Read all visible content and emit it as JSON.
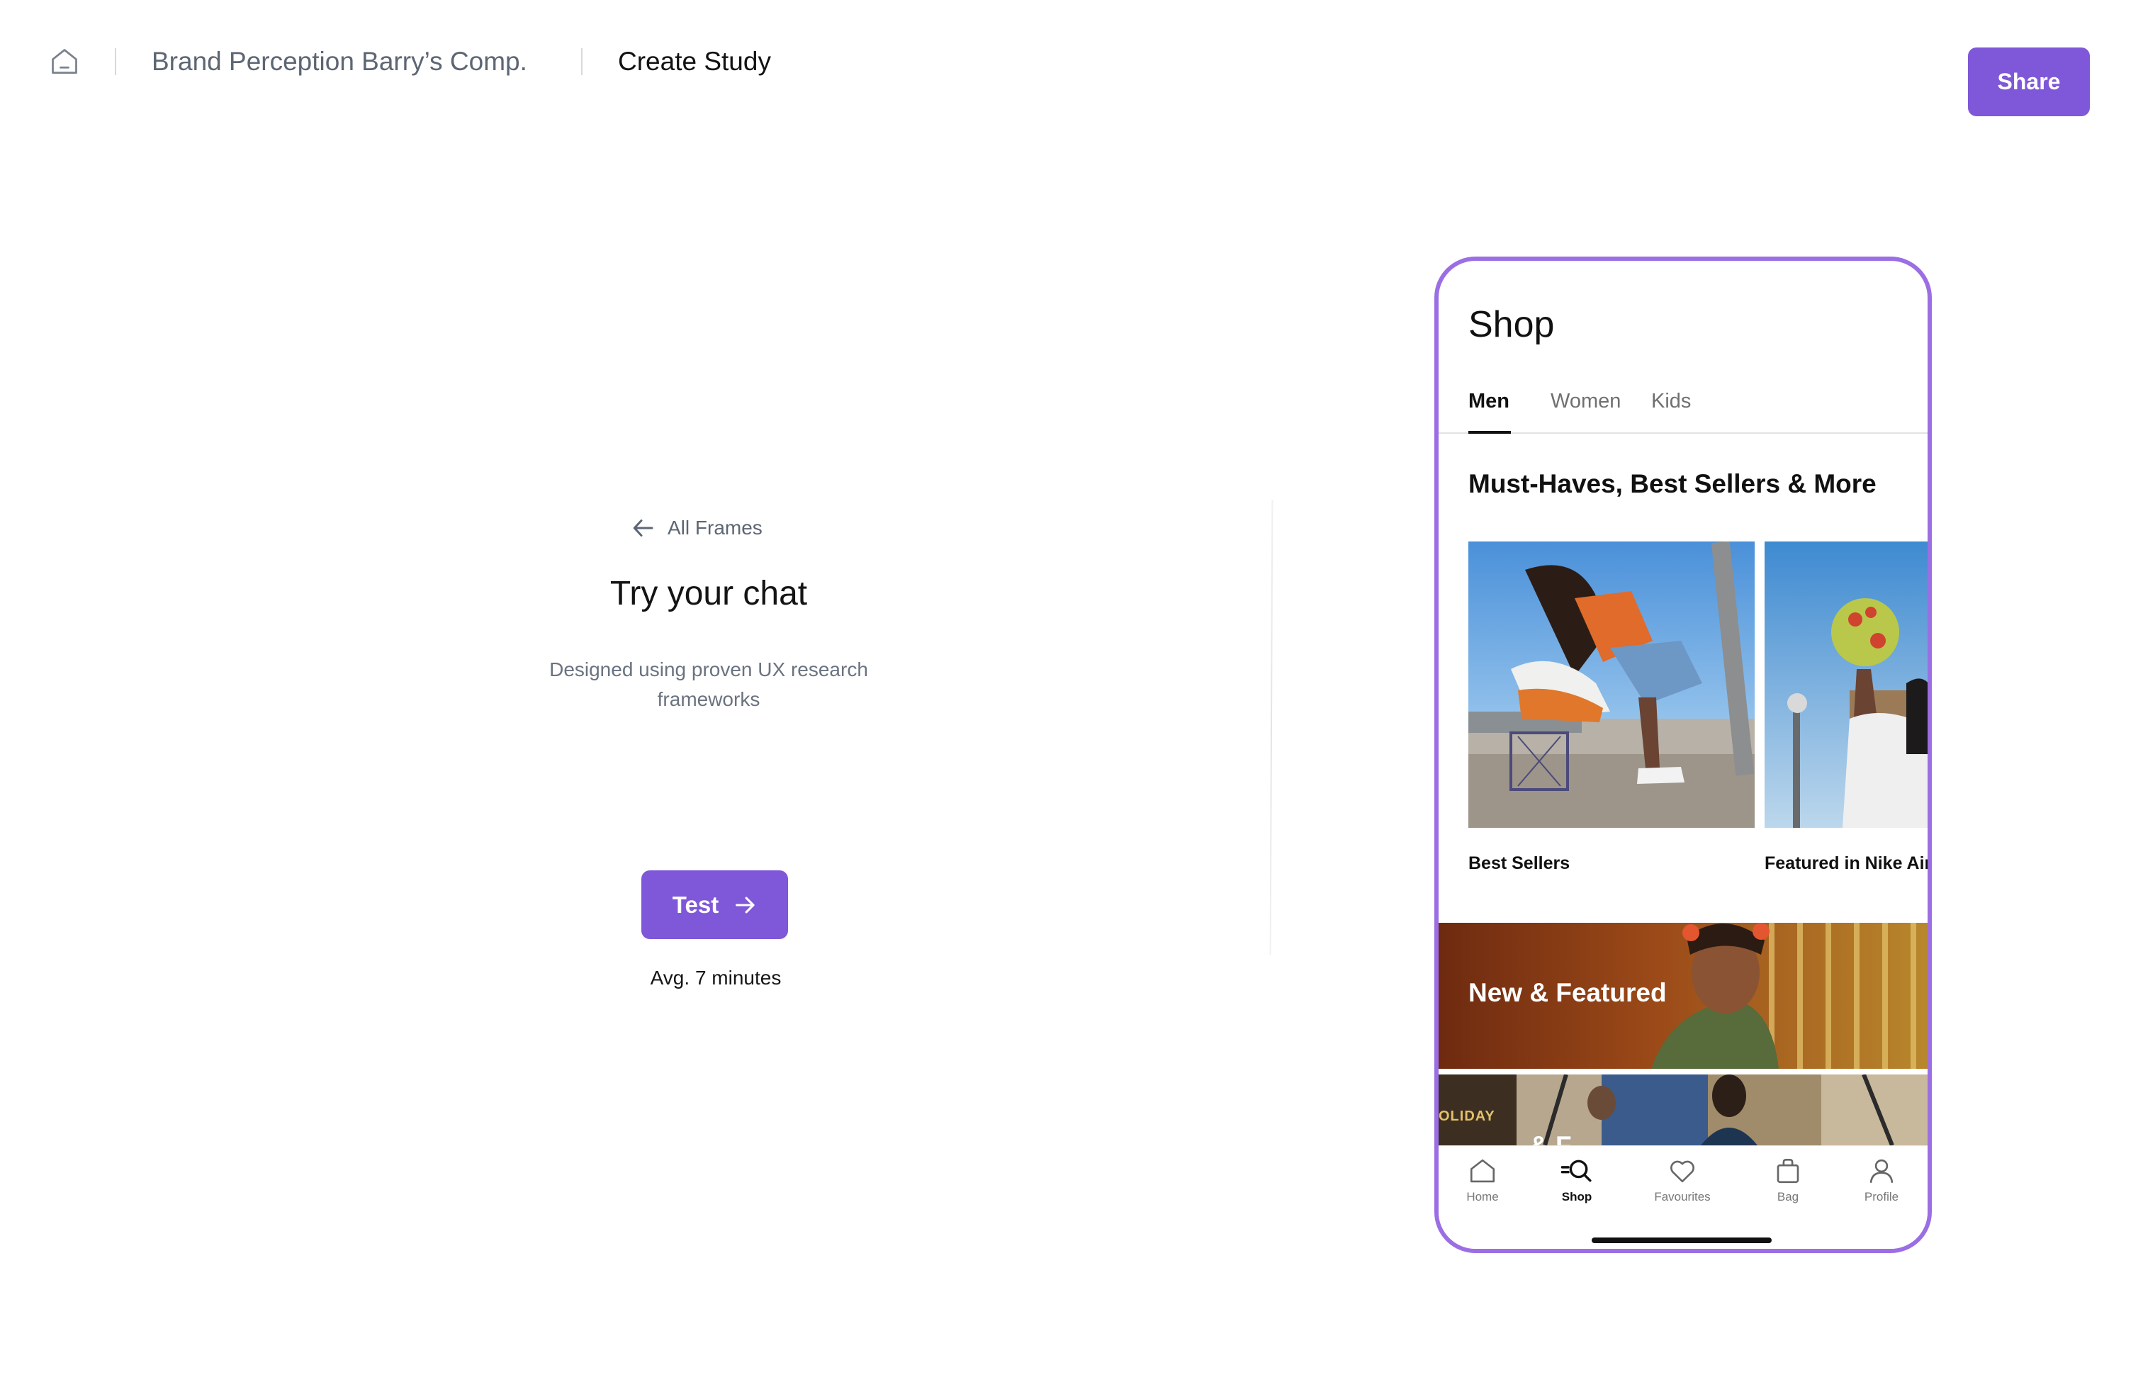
{
  "header": {
    "home_icon": "home-icon",
    "project": "Brand Perception Barry’s Comp.",
    "current_page": "Create Study",
    "share_label": "Share"
  },
  "study": {
    "back_label": "All Frames",
    "title": "Try your chat",
    "subtitle": "Designed using proven UX research frameworks",
    "test_label": "Test",
    "avg_time": "Avg. 7 minutes"
  },
  "phone": {
    "title": "Shop",
    "tabs": [
      {
        "label": "Men",
        "active": true
      },
      {
        "label": "Women",
        "active": false
      },
      {
        "label": "Kids",
        "active": false
      }
    ],
    "section_heading": "Must-Haves, Best Sellers & More",
    "cards": [
      {
        "label": "Best Sellers"
      },
      {
        "label": "Featured in Nike Air"
      }
    ],
    "banner_label": "New & Featured",
    "banner2_fragments": [
      "OLIDAY",
      "& F"
    ],
    "nav": [
      {
        "label": "Home",
        "icon": "home-icon",
        "active": false
      },
      {
        "label": "Shop",
        "icon": "search-icon",
        "active": true
      },
      {
        "label": "Favourites",
        "icon": "heart-icon",
        "active": false
      },
      {
        "label": "Bag",
        "icon": "bag-icon",
        "active": false
      },
      {
        "label": "Profile",
        "icon": "profile-icon",
        "active": false
      }
    ]
  },
  "colors": {
    "accent": "#7f57d9",
    "phone_border": "#9b6fe3",
    "muted_text": "#5d6673"
  }
}
